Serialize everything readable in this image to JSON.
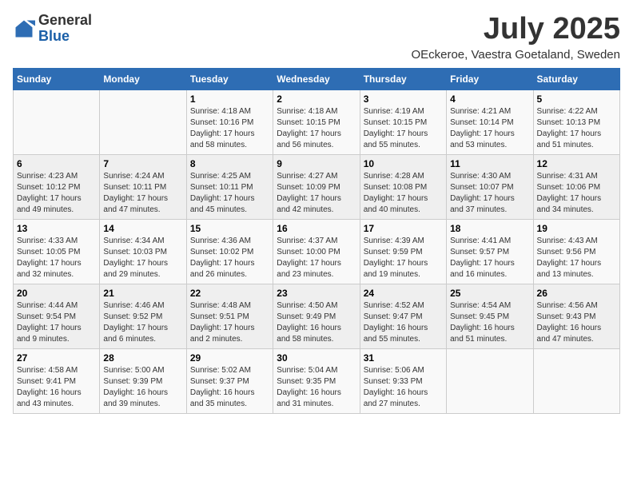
{
  "header": {
    "logo_general": "General",
    "logo_blue": "Blue",
    "month_title": "July 2025",
    "location": "OEckeroe, Vaestra Goetaland, Sweden"
  },
  "weekdays": [
    "Sunday",
    "Monday",
    "Tuesday",
    "Wednesday",
    "Thursday",
    "Friday",
    "Saturday"
  ],
  "weeks": [
    [
      {
        "day": "",
        "content": ""
      },
      {
        "day": "",
        "content": ""
      },
      {
        "day": "1",
        "content": "Sunrise: 4:18 AM\nSunset: 10:16 PM\nDaylight: 17 hours and 58 minutes."
      },
      {
        "day": "2",
        "content": "Sunrise: 4:18 AM\nSunset: 10:15 PM\nDaylight: 17 hours and 56 minutes."
      },
      {
        "day": "3",
        "content": "Sunrise: 4:19 AM\nSunset: 10:15 PM\nDaylight: 17 hours and 55 minutes."
      },
      {
        "day": "4",
        "content": "Sunrise: 4:21 AM\nSunset: 10:14 PM\nDaylight: 17 hours and 53 minutes."
      },
      {
        "day": "5",
        "content": "Sunrise: 4:22 AM\nSunset: 10:13 PM\nDaylight: 17 hours and 51 minutes."
      }
    ],
    [
      {
        "day": "6",
        "content": "Sunrise: 4:23 AM\nSunset: 10:12 PM\nDaylight: 17 hours and 49 minutes."
      },
      {
        "day": "7",
        "content": "Sunrise: 4:24 AM\nSunset: 10:11 PM\nDaylight: 17 hours and 47 minutes."
      },
      {
        "day": "8",
        "content": "Sunrise: 4:25 AM\nSunset: 10:11 PM\nDaylight: 17 hours and 45 minutes."
      },
      {
        "day": "9",
        "content": "Sunrise: 4:27 AM\nSunset: 10:09 PM\nDaylight: 17 hours and 42 minutes."
      },
      {
        "day": "10",
        "content": "Sunrise: 4:28 AM\nSunset: 10:08 PM\nDaylight: 17 hours and 40 minutes."
      },
      {
        "day": "11",
        "content": "Sunrise: 4:30 AM\nSunset: 10:07 PM\nDaylight: 17 hours and 37 minutes."
      },
      {
        "day": "12",
        "content": "Sunrise: 4:31 AM\nSunset: 10:06 PM\nDaylight: 17 hours and 34 minutes."
      }
    ],
    [
      {
        "day": "13",
        "content": "Sunrise: 4:33 AM\nSunset: 10:05 PM\nDaylight: 17 hours and 32 minutes."
      },
      {
        "day": "14",
        "content": "Sunrise: 4:34 AM\nSunset: 10:03 PM\nDaylight: 17 hours and 29 minutes."
      },
      {
        "day": "15",
        "content": "Sunrise: 4:36 AM\nSunset: 10:02 PM\nDaylight: 17 hours and 26 minutes."
      },
      {
        "day": "16",
        "content": "Sunrise: 4:37 AM\nSunset: 10:00 PM\nDaylight: 17 hours and 23 minutes."
      },
      {
        "day": "17",
        "content": "Sunrise: 4:39 AM\nSunset: 9:59 PM\nDaylight: 17 hours and 19 minutes."
      },
      {
        "day": "18",
        "content": "Sunrise: 4:41 AM\nSunset: 9:57 PM\nDaylight: 17 hours and 16 minutes."
      },
      {
        "day": "19",
        "content": "Sunrise: 4:43 AM\nSunset: 9:56 PM\nDaylight: 17 hours and 13 minutes."
      }
    ],
    [
      {
        "day": "20",
        "content": "Sunrise: 4:44 AM\nSunset: 9:54 PM\nDaylight: 17 hours and 9 minutes."
      },
      {
        "day": "21",
        "content": "Sunrise: 4:46 AM\nSunset: 9:52 PM\nDaylight: 17 hours and 6 minutes."
      },
      {
        "day": "22",
        "content": "Sunrise: 4:48 AM\nSunset: 9:51 PM\nDaylight: 17 hours and 2 minutes."
      },
      {
        "day": "23",
        "content": "Sunrise: 4:50 AM\nSunset: 9:49 PM\nDaylight: 16 hours and 58 minutes."
      },
      {
        "day": "24",
        "content": "Sunrise: 4:52 AM\nSunset: 9:47 PM\nDaylight: 16 hours and 55 minutes."
      },
      {
        "day": "25",
        "content": "Sunrise: 4:54 AM\nSunset: 9:45 PM\nDaylight: 16 hours and 51 minutes."
      },
      {
        "day": "26",
        "content": "Sunrise: 4:56 AM\nSunset: 9:43 PM\nDaylight: 16 hours and 47 minutes."
      }
    ],
    [
      {
        "day": "27",
        "content": "Sunrise: 4:58 AM\nSunset: 9:41 PM\nDaylight: 16 hours and 43 minutes."
      },
      {
        "day": "28",
        "content": "Sunrise: 5:00 AM\nSunset: 9:39 PM\nDaylight: 16 hours and 39 minutes."
      },
      {
        "day": "29",
        "content": "Sunrise: 5:02 AM\nSunset: 9:37 PM\nDaylight: 16 hours and 35 minutes."
      },
      {
        "day": "30",
        "content": "Sunrise: 5:04 AM\nSunset: 9:35 PM\nDaylight: 16 hours and 31 minutes."
      },
      {
        "day": "31",
        "content": "Sunrise: 5:06 AM\nSunset: 9:33 PM\nDaylight: 16 hours and 27 minutes."
      },
      {
        "day": "",
        "content": ""
      },
      {
        "day": "",
        "content": ""
      }
    ]
  ]
}
